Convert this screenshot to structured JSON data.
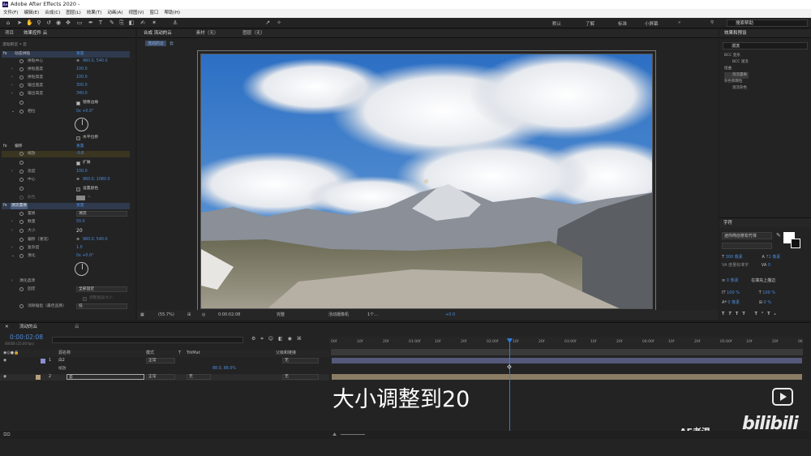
{
  "window": {
    "title": "Adobe After Effects 2020 -",
    "badge": "Ae"
  },
  "menu": [
    "文件(F)",
    "编辑(E)",
    "合成(C)",
    "图层(L)",
    "效果(T)",
    "动画(A)",
    "视图(V)",
    "窗口",
    "帮助(H)"
  ],
  "toolbar": {
    "workspaces": [
      "默认",
      "了解",
      "标准",
      "小屏幕"
    ],
    "search_placeholder": "搜索帮助"
  },
  "left_panel": {
    "tabs": [
      "项目",
      "效果控件 云"
    ],
    "breadcrumb": "流动的云 • 云",
    "sections": [
      {
        "name": "动态拼贴",
        "reset": "重置"
      },
      {
        "name": "偏移",
        "reset": "重置"
      },
      {
        "name": "湍流置换",
        "reset": "重置"
      }
    ],
    "rows": [
      {
        "label": "拼贴中心",
        "value": "960.0, 540.0"
      },
      {
        "label": "拼贴宽度",
        "value": "100.0"
      },
      {
        "label": "拼贴高度",
        "value": "100.0"
      },
      {
        "label": "输出宽度",
        "value": "300.0"
      },
      {
        "label": "输出高度",
        "value": "340.0"
      },
      {
        "label": "镜像边缘",
        "value": ""
      },
      {
        "label": "相位",
        "value": "0x +0.0°"
      },
      {
        "label": "水平位移",
        "value": ""
      },
      {
        "label": "缩放",
        "value": "-0.8"
      },
      {
        "label": "扩展",
        "value": ""
      },
      {
        "label": "亮度",
        "value": "100.0"
      },
      {
        "label": "中心",
        "value": "960.0, 1080.0"
      },
      {
        "label": "设置颜色",
        "value": ""
      },
      {
        "label": "颜色",
        "value": ""
      },
      {
        "label": "置换",
        "value": "湍流"
      },
      {
        "label": "数量",
        "value": "50.0"
      },
      {
        "label": "大小",
        "value": "20"
      },
      {
        "label": "偏移（湍流）",
        "value": "960.0, 540.0"
      },
      {
        "label": "复杂度",
        "value": "1.0"
      },
      {
        "label": "演化",
        "value": "0x +0.0°"
      },
      {
        "label": "演化选项",
        "value": ""
      },
      {
        "label": "固定",
        "value": "全部固定"
      },
      {
        "label": "调整图层大小",
        "value": ""
      },
      {
        "label": "消除锯齿（最佳品质）",
        "value": "低"
      }
    ]
  },
  "composition": {
    "tabs": [
      "合成 流动的云",
      "素材（无）",
      "图层（无）"
    ],
    "breadcrumb": [
      "流动的云",
      "云"
    ],
    "footer": {
      "zoom": "(55.7%)",
      "time": "0:00:02:08",
      "quality": "完整",
      "camera": "活动摄像机",
      "views": "1个...",
      "exposure": "+0.0"
    }
  },
  "right_panel": {
    "effects_title": "效果和预设",
    "search_value": "湍流",
    "tree": [
      "BCC 变形",
      "BCC 湍流",
      "扭曲",
      "湍流置换",
      "杂色和颗粒",
      "湍流杂色"
    ],
    "character_title": "字符",
    "font": "迷你简创意松竹体",
    "size": "300 像素",
    "leading": "71 像素",
    "tracking_label": "度量标准字",
    "tracking_value": "0",
    "stroke_width": "0 像素",
    "stroke_type": "在填充上描边",
    "vscale": "100 %",
    "hscale": "100 %",
    "baseline": "0 像素",
    "tsume": "0 %"
  },
  "timeline": {
    "comp_tab": "流动的云",
    "layer_tab": "云",
    "timecode": "0:00:02:08",
    "frame_info": "00058 (25.00 fps)",
    "columns": {
      "source": "源名称",
      "mode": "模式",
      "t": "T",
      "trkmat": "TrkMat",
      "parent": "父级和链接"
    },
    "ruler": [
      "00f",
      "10f",
      "20f",
      "01:00f",
      "10f",
      "20f",
      "02:00f",
      "10f",
      "20f",
      "03:00f",
      "10f",
      "20f",
      "04:00f",
      "10f",
      "20f",
      "05:00f",
      "10f",
      "20f",
      "06"
    ],
    "layers": [
      {
        "index": "1",
        "name": "白2",
        "mode": "正常",
        "trkmat": "",
        "parent": "无"
      },
      {
        "index": "",
        "name": "缩放",
        "mode": "",
        "trkmat": "",
        "parent": "",
        "value": "88.0, 88.0%"
      },
      {
        "index": "2",
        "name": "云",
        "mode": "正常",
        "trkmat": "无",
        "parent": "无"
      }
    ]
  },
  "subtitle": "大小调整到20",
  "watermark": {
    "text": "AE老温",
    "logo": "bilibili"
  },
  "colors": {
    "accent": "#4b8bdb",
    "playhead": "#2b7de0",
    "track": "#8a7d64"
  }
}
